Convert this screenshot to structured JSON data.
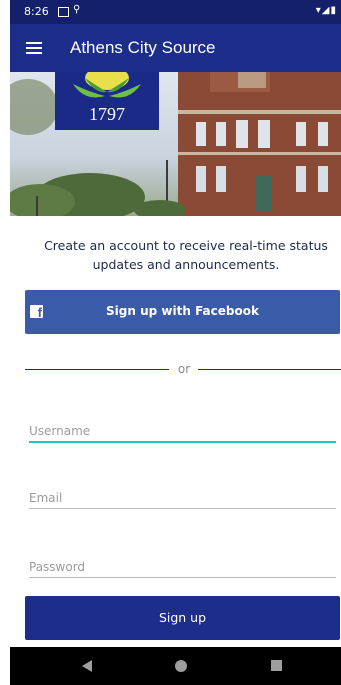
{
  "status_bar": {
    "time": "8:26",
    "location_symbol": "⚲",
    "right_icons": "▾◢▮"
  },
  "app_bar": {
    "title": "Athens City Source",
    "menu_icon": "hamburger-menu-icon"
  },
  "hero": {
    "seal_year": "1797"
  },
  "intro_text": "Create an account to receive real-time status updates and announcements.",
  "facebook_button": {
    "label": "Sign up with Facebook",
    "icon": "facebook-icon",
    "icon_letter": "f"
  },
  "divider_text": "or",
  "form": {
    "username_placeholder": "Username",
    "email_placeholder": "Email",
    "password_placeholder": "Password"
  },
  "signup_button": {
    "label": "Sign up"
  },
  "colors": {
    "primary": "#1c2d8a",
    "status_bar": "#14206b",
    "facebook": "#3a5ba8",
    "focus_accent": "#2cbfc4"
  }
}
